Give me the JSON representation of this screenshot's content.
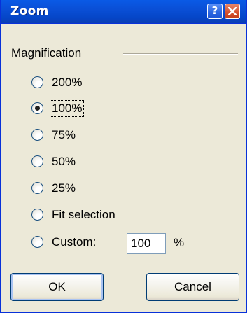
{
  "window": {
    "title": "Zoom",
    "help_glyph": "?"
  },
  "magnification": {
    "group_label": "Magnification",
    "options": [
      {
        "label": "200%",
        "selected": false
      },
      {
        "label": "100%",
        "selected": true
      },
      {
        "label": "75%",
        "selected": false
      },
      {
        "label": "50%",
        "selected": false
      },
      {
        "label": "25%",
        "selected": false
      },
      {
        "label": "Fit selection",
        "selected": false
      },
      {
        "label": "Custom:",
        "selected": false
      }
    ],
    "custom_value": "100",
    "custom_unit": "%"
  },
  "buttons": {
    "ok": "OK",
    "cancel": "Cancel"
  },
  "colors": {
    "titlebar": "#0a4fd6",
    "close": "#d6502d",
    "background": "#ece9d8"
  },
  "icons": {
    "help": "help-icon",
    "close": "close-icon"
  }
}
